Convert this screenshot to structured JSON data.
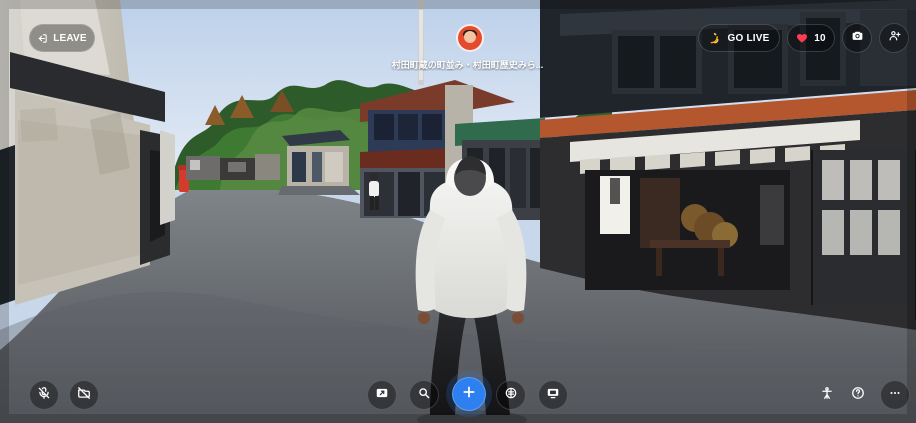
{
  "top_bar": {
    "leave_label": "LEAVE",
    "location_title": "村田町蔵の町並み・村田町歴史みら...",
    "go_live_label": "GO LIVE",
    "likes_count": "10"
  },
  "icons": {
    "leave": "leave-icon",
    "go_live": "go-live-icon",
    "heart": "heart-icon",
    "camera": "camera-icon",
    "add_person": "add-person-icon",
    "mic_off": "mic-off-icon",
    "video_off": "video-off-icon",
    "share": "share-icon",
    "search": "search-icon",
    "plus": "plus-icon",
    "emoji": "emoji-icon",
    "screen": "screen-share-icon",
    "accessibility": "accessibility-icon",
    "help": "help-icon",
    "more": "more-icon"
  },
  "colors": {
    "accent_blue": "#2e7ff0",
    "heart_red": "#ff3b4f",
    "avatar_bg": "#e34b2c"
  }
}
